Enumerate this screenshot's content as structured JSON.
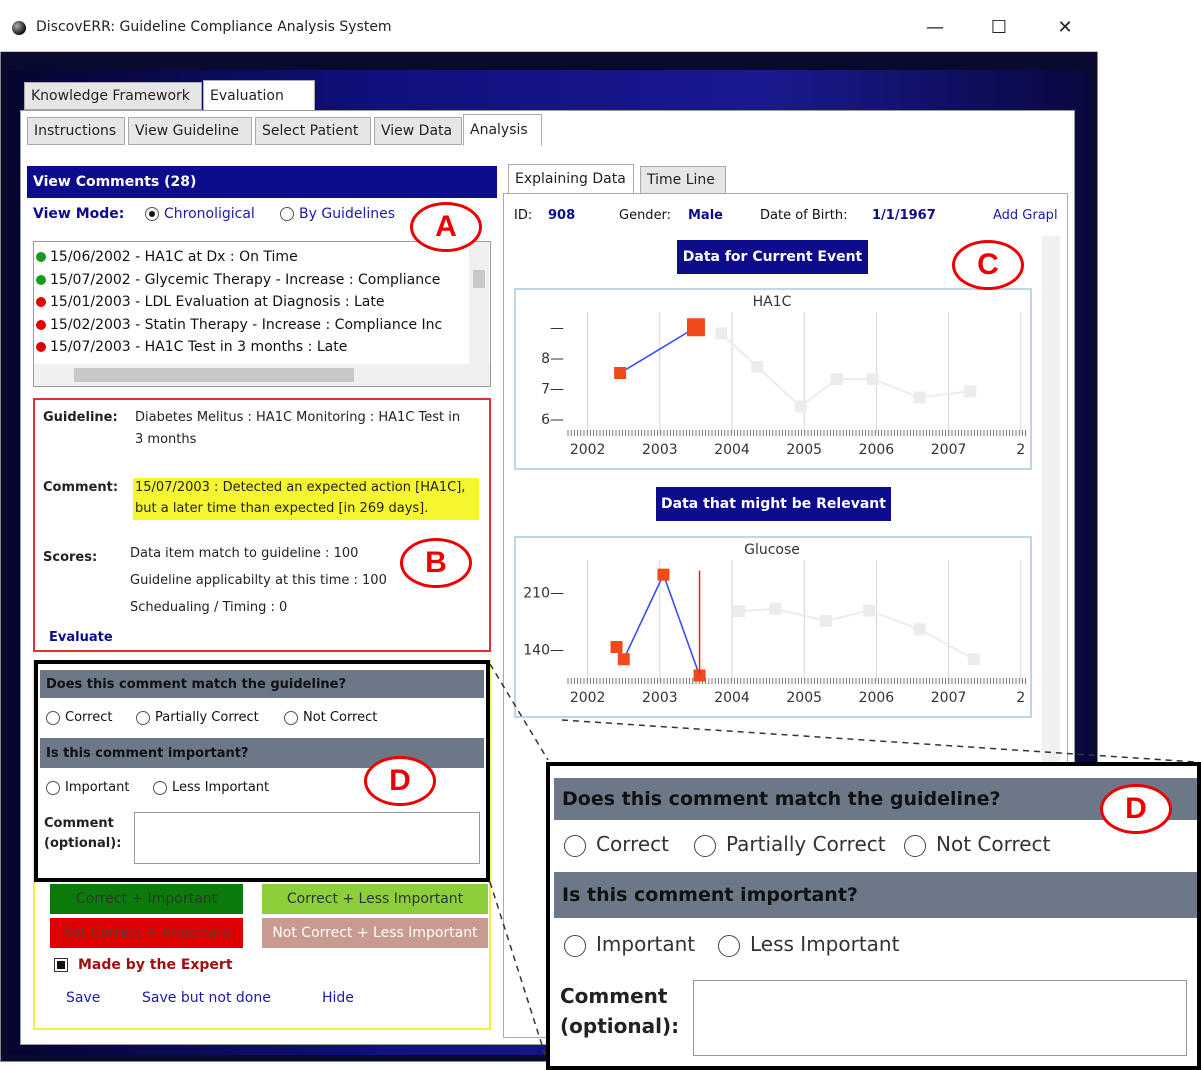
{
  "window": {
    "title": "DiscovERR: Guideline Compliance Analysis System",
    "min_glyph": "—",
    "max_glyph": "☐",
    "close_glyph": "✕"
  },
  "main_tabs": [
    {
      "label": "Knowledge Framework"
    },
    {
      "label": "Evaluation"
    }
  ],
  "sub_tabs": [
    {
      "label": "Instructions"
    },
    {
      "label": "View Guideline"
    },
    {
      "label": "Select Patient"
    },
    {
      "label": "View Data"
    },
    {
      "label": "Analysis"
    }
  ],
  "comments": {
    "header": "View Comments (28)",
    "view_mode_label": "View Mode:",
    "modes": [
      {
        "label": "Chronoligical",
        "selected": true
      },
      {
        "label": "By Guidelines",
        "selected": false
      }
    ],
    "items": [
      {
        "text": "15/06/2002 - HA1C at Dx : On Time",
        "color": "#1a9a1a"
      },
      {
        "text": "15/07/2002 - Glycemic Therapy - Increase : Compliance",
        "color": "#1a9a1a"
      },
      {
        "text": "15/01/2003 - LDL Evaluation at Diagnosis : Late",
        "color": "#e00000"
      },
      {
        "text": "15/02/2003 - Statin Therapy - Increase : Compliance Inc",
        "color": "#e00000"
      },
      {
        "text": "15/07/2003 - HA1C Test in 3 months : Late",
        "color": "#e00000"
      }
    ]
  },
  "detail": {
    "guideline_label": "Guideline:",
    "guideline_line1": "Diabetes Melitus : HA1C Monitoring : HA1C Test in",
    "guideline_line2": "3 months",
    "comment_label": "Comment:",
    "comment_line1": "15/07/2003 : Detected an expected action [HA1C],",
    "comment_line2": "but a later time than expected [in 269 days].",
    "scores_label": "Scores:",
    "scores": [
      "Data item match to guideline : 100",
      "Guideline applicabilty at this time : 100",
      "Schedualing / Timing : 0"
    ],
    "evaluate_link": "Evaluate"
  },
  "evaluation": {
    "q1": "Does this comment match the guideline?",
    "q1_options": [
      "Correct",
      "Partially Correct",
      "Not Correct"
    ],
    "q2": "Is this comment important?",
    "q2_options": [
      "Important",
      "Less Important"
    ],
    "comment_label_1": "Comment",
    "comment_label_2": "(optional):"
  },
  "categories": [
    {
      "label": "Correct + Important",
      "color": "#0a7a0a"
    },
    {
      "label": "Correct + Less Important",
      "color": "#8ccf3a"
    },
    {
      "label": "Not Correct + Important",
      "color": "#e00000"
    },
    {
      "label": "Not Correct + Less Important",
      "color": "#c89a90"
    }
  ],
  "expert": {
    "label": "Made by the Expert",
    "checked": true
  },
  "actions": [
    "Save",
    "Save but not done",
    "Hide"
  ],
  "right": {
    "tabs": [
      {
        "label": "Explaining Data"
      },
      {
        "label": "Time Line"
      }
    ],
    "id_label": "ID:",
    "id_value": "908",
    "gender_label": "Gender:",
    "gender_value": "Male",
    "dob_label": "Date of Birth:",
    "dob_value": "1/1/1967",
    "add_graph": "Add Grapl",
    "current_event_btn": "Data for Current Event",
    "relevant_btn": "Data that might be Relevant"
  },
  "callouts": {
    "a": "A",
    "b": "B",
    "c": "C",
    "d": "D",
    "d2": "D"
  },
  "chart_data": [
    {
      "type": "line",
      "title": "HA1C",
      "x_ticks": [
        "2002",
        "2003",
        "2004",
        "2005",
        "2006",
        "2007",
        "2"
      ],
      "y_ticks": [
        "6—",
        "7—",
        "8—",
        "—"
      ],
      "ylim": [
        5.5,
        9.5
      ],
      "xlim": [
        2001.7,
        2008.1
      ],
      "series": [
        {
          "values": [
            {
              "x": 2002.45,
              "y": 7.5
            },
            {
              "x": 2003.5,
              "y": 9.0
            }
          ],
          "highlight": true
        },
        {
          "values": [
            {
              "x": 2003.85,
              "y": 8.8
            },
            {
              "x": 2004.35,
              "y": 7.7
            },
            {
              "x": 2004.95,
              "y": 6.4
            },
            {
              "x": 2005.45,
              "y": 7.3
            },
            {
              "x": 2005.95,
              "y": 7.3
            },
            {
              "x": 2006.6,
              "y": 6.7
            },
            {
              "x": 2007.3,
              "y": 6.9
            }
          ],
          "highlight": false
        }
      ]
    },
    {
      "type": "line",
      "title": "Glucose",
      "x_ticks": [
        "2002",
        "2003",
        "2004",
        "2005",
        "2006",
        "2007",
        "2"
      ],
      "y_ticks": [
        "140—",
        "210—"
      ],
      "ylim": [
        100,
        250
      ],
      "xlim": [
        2001.7,
        2008.1
      ],
      "series": [
        {
          "values": [
            {
              "x": 2002.4,
              "y": 143
            },
            {
              "x": 2002.5,
              "y": 128
            },
            {
              "x": 2003.05,
              "y": 232
            },
            {
              "x": 2003.55,
              "y": 108
            }
          ],
          "highlight": true
        },
        {
          "values": [
            {
              "x": 2004.1,
              "y": 187
            },
            {
              "x": 2004.6,
              "y": 190
            },
            {
              "x": 2005.3,
              "y": 175
            },
            {
              "x": 2005.9,
              "y": 188
            },
            {
              "x": 2006.6,
              "y": 165
            },
            {
              "x": 2007.35,
              "y": 128
            }
          ],
          "highlight": false
        }
      ],
      "marker_line": {
        "x": 2003.55,
        "y_from": 108,
        "y_to": 237
      }
    }
  ]
}
